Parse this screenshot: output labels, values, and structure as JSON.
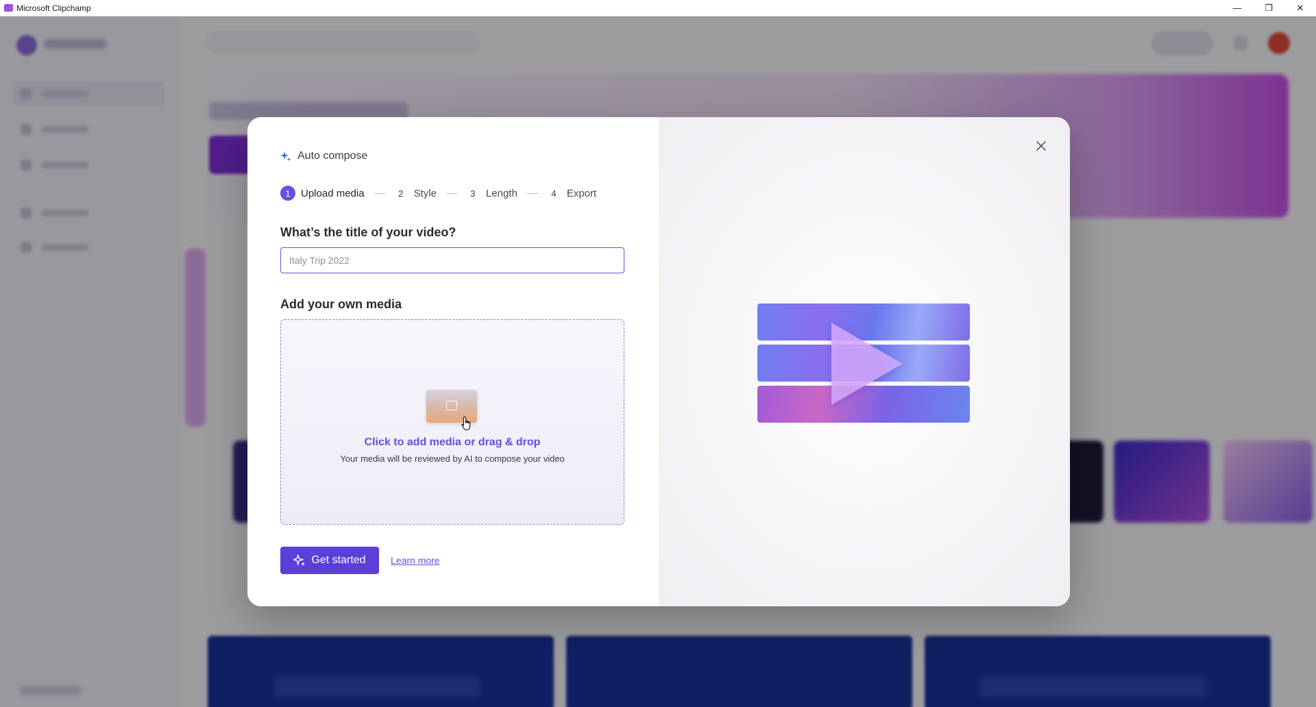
{
  "window": {
    "title": "Microsoft Clipchamp",
    "controls": {
      "minimize": "—",
      "restore": "❐",
      "close": "✕"
    }
  },
  "dialog": {
    "header": {
      "icon": "sparkle-icon",
      "title": "Auto compose"
    },
    "steps": [
      {
        "number": "1",
        "label": "Upload media",
        "active": true
      },
      {
        "number": "2",
        "label": "Style",
        "active": false
      },
      {
        "number": "3",
        "label": "Length",
        "active": false
      },
      {
        "number": "4",
        "label": "Export",
        "active": false
      }
    ],
    "title_question": "What’s the title of your video?",
    "title_input": {
      "value": "",
      "placeholder": "Italy Trip 2022"
    },
    "media_heading": "Add your own media",
    "dropzone": {
      "link_text": "Click to add media or drag & drop",
      "subtext": "Your media will be reviewed by AI to compose your video"
    },
    "get_started_label": "Get started",
    "learn_more_label": "Learn more",
    "close_icon": "close-icon"
  },
  "colors": {
    "accent": "#5b3fd8",
    "link": "#6b4be0"
  }
}
